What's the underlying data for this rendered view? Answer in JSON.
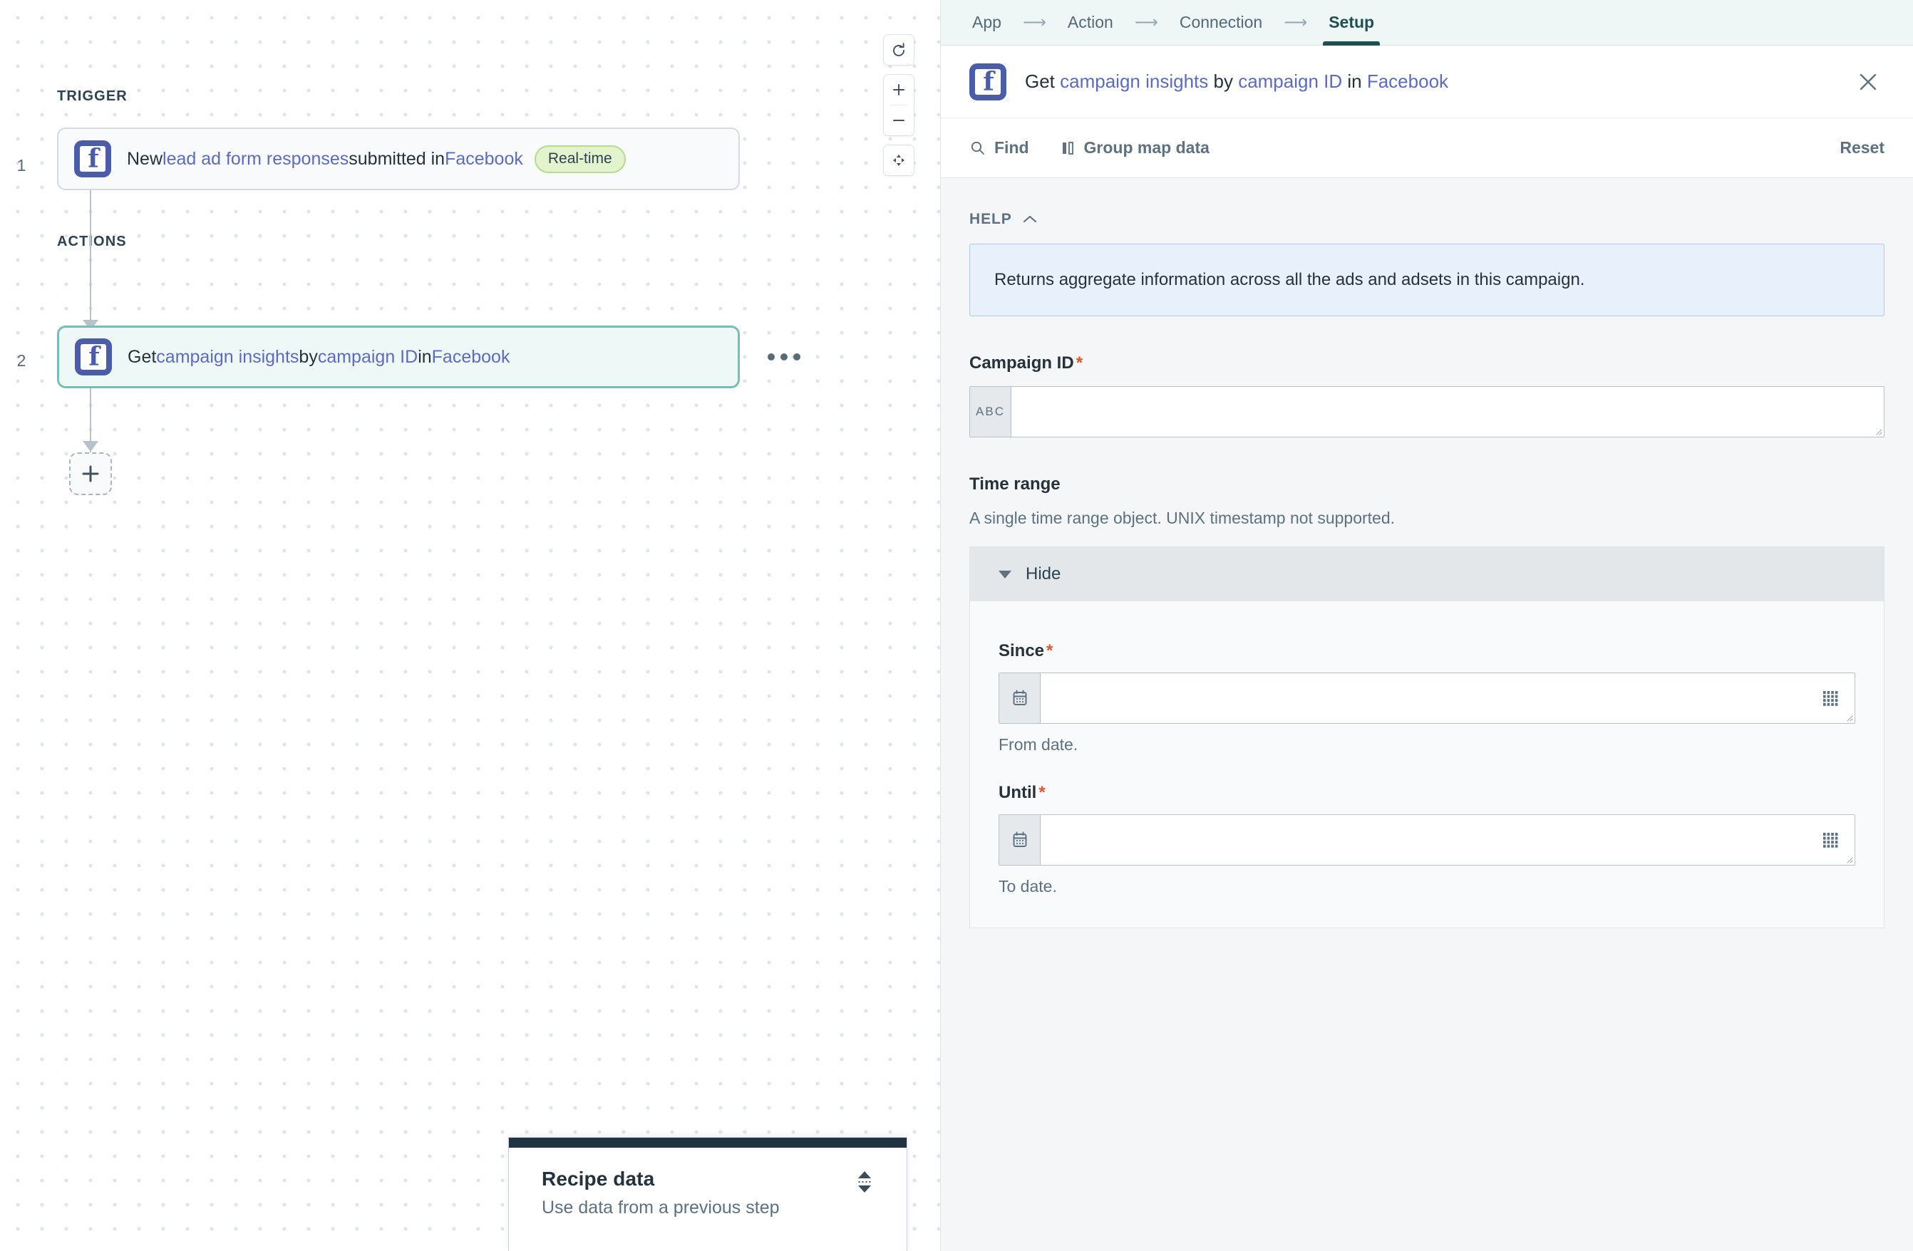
{
  "canvas": {
    "trigger_section_label": "TRIGGER",
    "actions_section_label": "ACTIONS",
    "steps": [
      {
        "number": "1",
        "icon": "facebook-icon",
        "text_parts": [
          {
            "t": "New ",
            "link": false
          },
          {
            "t": "lead ad form responses",
            "link": true
          },
          {
            "t": " submitted in ",
            "link": false
          },
          {
            "t": "Facebook",
            "link": true
          }
        ],
        "badge": "Real-time"
      },
      {
        "number": "2",
        "icon": "facebook-icon",
        "text_parts": [
          {
            "t": "Get ",
            "link": false
          },
          {
            "t": "campaign insights",
            "link": true
          },
          {
            "t": " by ",
            "link": false
          },
          {
            "t": "campaign ID",
            "link": true
          },
          {
            "t": " in ",
            "link": false
          },
          {
            "t": "Facebook",
            "link": true
          }
        ],
        "badge": ""
      }
    ],
    "add_step_label": "+",
    "tools": [
      {
        "name": "undo-icon",
        "label": ""
      },
      {
        "name": "zoom-in-icon",
        "label": "+"
      },
      {
        "name": "zoom-out-icon",
        "label": "−"
      },
      {
        "name": "fit-to-screen-icon",
        "label": ""
      }
    ],
    "selected_colors": {
      "selected_border": "#77bdba",
      "selected_bg": "#eef8f7",
      "badge_bg": "#e3f3cd",
      "badge_border": "#b4dc8a",
      "link_color": "#5c6bc0",
      "facebook_blue": "#4b5ca8"
    }
  },
  "recipe_data_panel": {
    "title": "Recipe data",
    "subtitle": "Use data from a previous step",
    "topbar_color": "#1f3442"
  },
  "panel": {
    "tabs": [
      {
        "label": "App",
        "active": false
      },
      {
        "label": "Action",
        "active": false
      },
      {
        "label": "Connection",
        "active": false
      },
      {
        "label": "Setup",
        "active": true
      }
    ],
    "tab_separator": "⟶",
    "header": {
      "icon": "facebook-icon",
      "title_parts": [
        {
          "t": "Get ",
          "link": false
        },
        {
          "t": "campaign insights",
          "link": true
        },
        {
          "t": " by ",
          "link": false
        },
        {
          "t": "campaign ID",
          "link": true
        },
        {
          "t": " in ",
          "link": false
        },
        {
          "t": "Facebook",
          "link": true
        }
      ],
      "close_icon": "close-icon"
    },
    "toolbar": {
      "find_label": "Find",
      "find_icon": "search-icon",
      "group_map_label": "Group map data",
      "group_map_icon": "group-map-icon",
      "reset_label": "Reset"
    },
    "help": {
      "heading": "HELP",
      "collapse_icon": "chevron-up-icon",
      "text": "Returns aggregate information across all the ads and adsets in this campaign.",
      "bg_color": "#e8f1fb",
      "border_color": "#a9cbee"
    },
    "campaign_id_field": {
      "label": "Campaign ID",
      "required_marker": "*",
      "type_prefix": "ABC",
      "value": "",
      "placeholder": ""
    },
    "time_range": {
      "title": "Time range",
      "description": "A single time range object. UNIX timestamp not supported.",
      "toggle_label": "Hide",
      "since": {
        "label": "Since",
        "required_marker": "*",
        "value": "",
        "placeholder": "",
        "hint": "From date.",
        "prefix_icon": "calendar-icon",
        "suffix_icon": "datapill-icon"
      },
      "until": {
        "label": "Until",
        "required_marker": "*",
        "value": "",
        "placeholder": "",
        "hint": "To date.",
        "prefix_icon": "calendar-icon",
        "suffix_icon": "datapill-icon"
      }
    }
  }
}
